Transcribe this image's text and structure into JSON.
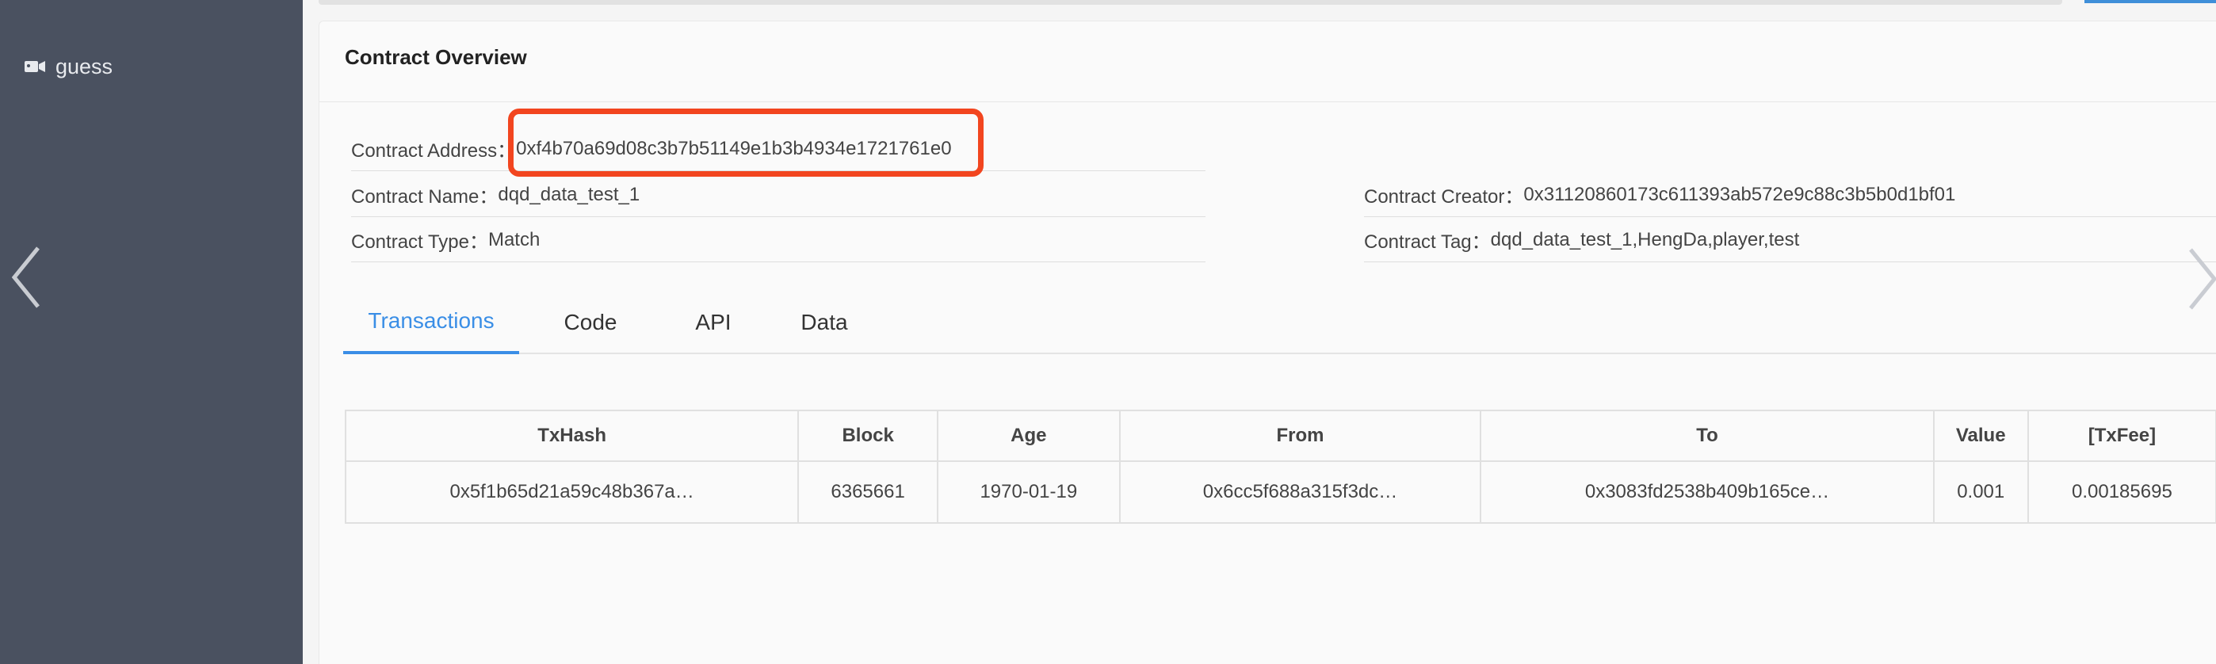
{
  "sidebar": {
    "item_label": "guess",
    "item_icon": "camera-icon"
  },
  "overview": {
    "title": "Contract Overview",
    "address_label": "Contract Address：",
    "address_value": "0xf4b70a69d08c3b7b51149e1b3b4934e1721761e0",
    "name_label": "Contract Name：",
    "name_value": "dqd_data_test_1",
    "type_label": "Contract Type：",
    "type_value": "Match",
    "creator_label": "Contract Creator：",
    "creator_value": "0x31120860173c611393ab572e9c88c3b5b0d1bf01",
    "tag_label": "Contract Tag：",
    "tag_value": "dqd_data_test_1,HengDa,player,test"
  },
  "tabs": [
    "Transactions",
    "Code",
    "API",
    "Data"
  ],
  "active_tab": "Transactions",
  "table": {
    "headers": [
      "TxHash",
      "Block",
      "Age",
      "From",
      "To",
      "Value",
      "[TxFee]"
    ],
    "rows": [
      [
        "0x5f1b65d21a59c48b367a…",
        "6365661",
        "1970-01-19",
        "0x6cc5f688a315f3dc…",
        "0x3083fd2538b409b165ce…",
        "0.001",
        "0.00185695"
      ]
    ]
  },
  "colors": {
    "sidebar_bg": "#4a5160",
    "accent": "#3a8ee6",
    "highlight": "#f2451f"
  }
}
